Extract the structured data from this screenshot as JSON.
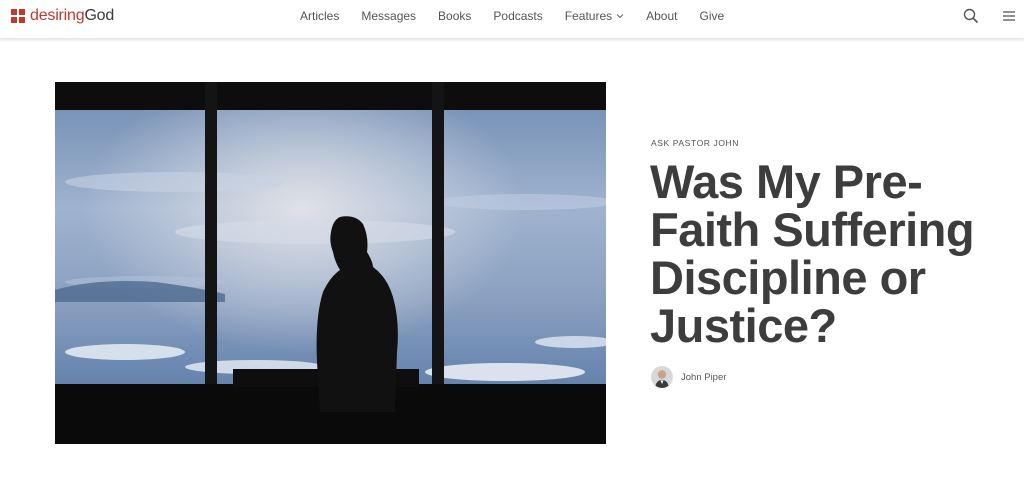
{
  "header": {
    "logo_part1": "desiring",
    "logo_part2": "God",
    "nav": [
      {
        "label": "Articles"
      },
      {
        "label": "Messages"
      },
      {
        "label": "Books"
      },
      {
        "label": "Podcasts"
      },
      {
        "label": "Features"
      },
      {
        "label": "About"
      },
      {
        "label": "Give"
      }
    ],
    "icons": {
      "search": "search-icon",
      "menu": "hamburger-menu-icon",
      "features_dropdown": "chevron-down-icon"
    }
  },
  "article": {
    "kicker": "Ask Pastor John",
    "title": "Was My Pre-Faith Suffering Discipline or Justice?",
    "author": "John Piper"
  },
  "colors": {
    "brand_red": "#c0392b",
    "title_text": "#3d3d3d"
  }
}
